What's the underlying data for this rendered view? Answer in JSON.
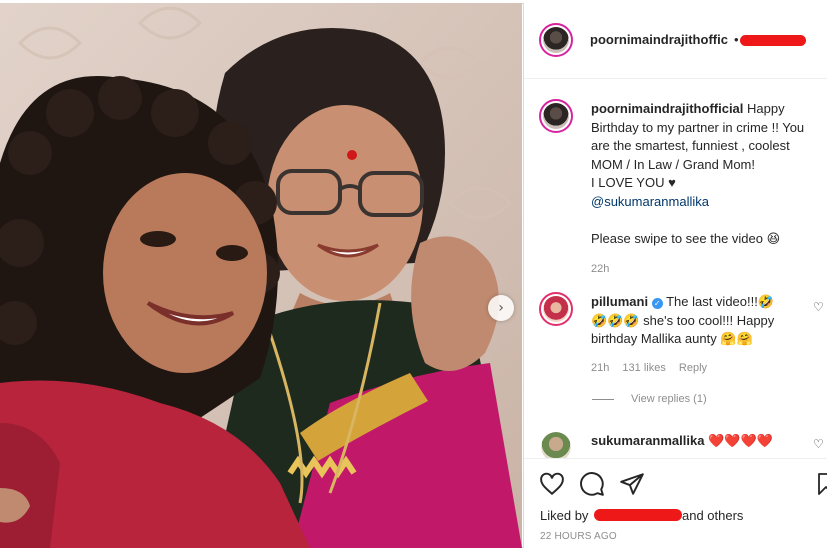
{
  "post": {
    "author": "poornimaindrajithoffic",
    "author_dot": "•",
    "caption_author": "poornimaindrajithofficial",
    "caption_lines": [
      "Birthday to my partner in crime !! You",
      "are the smartest, funniest , coolest",
      "MOM / In Law / Grand Mom!",
      "I LOVE YOU ♥"
    ],
    "caption_first": "Happy",
    "caption_mention": "@sukumaranmallika",
    "caption_after": "Please swipe to see the video 😆",
    "caption_age": "22h"
  },
  "comments": [
    {
      "user": "pillumani",
      "text_first": "The last video!!!🤣",
      "text_lines": [
        "🤣🤣🤣 she's too cool!!! Happy",
        "birthday Mallika aunty 🤗🤗"
      ],
      "age": "21h",
      "likes": "131 likes",
      "reply": "Reply",
      "view_replies": "View replies (1)"
    },
    {
      "user": "sukumaranmallika",
      "text_first": "❤️❤️❤️❤️"
    }
  ],
  "footer": {
    "liked_by": "Liked by",
    "and_others": "and others",
    "timestamp": "22 HOURS AGO"
  },
  "icons": {
    "next": "chevron-right-icon",
    "like": "heart-icon",
    "comment": "comment-icon",
    "share": "paper-plane-icon",
    "save": "bookmark-icon"
  },
  "colors": {
    "redaction": "#ef1818",
    "mention": "#00376b",
    "muted": "#8e8e8e",
    "verified": "#3897f0",
    "story_ring": "#d6249f"
  }
}
